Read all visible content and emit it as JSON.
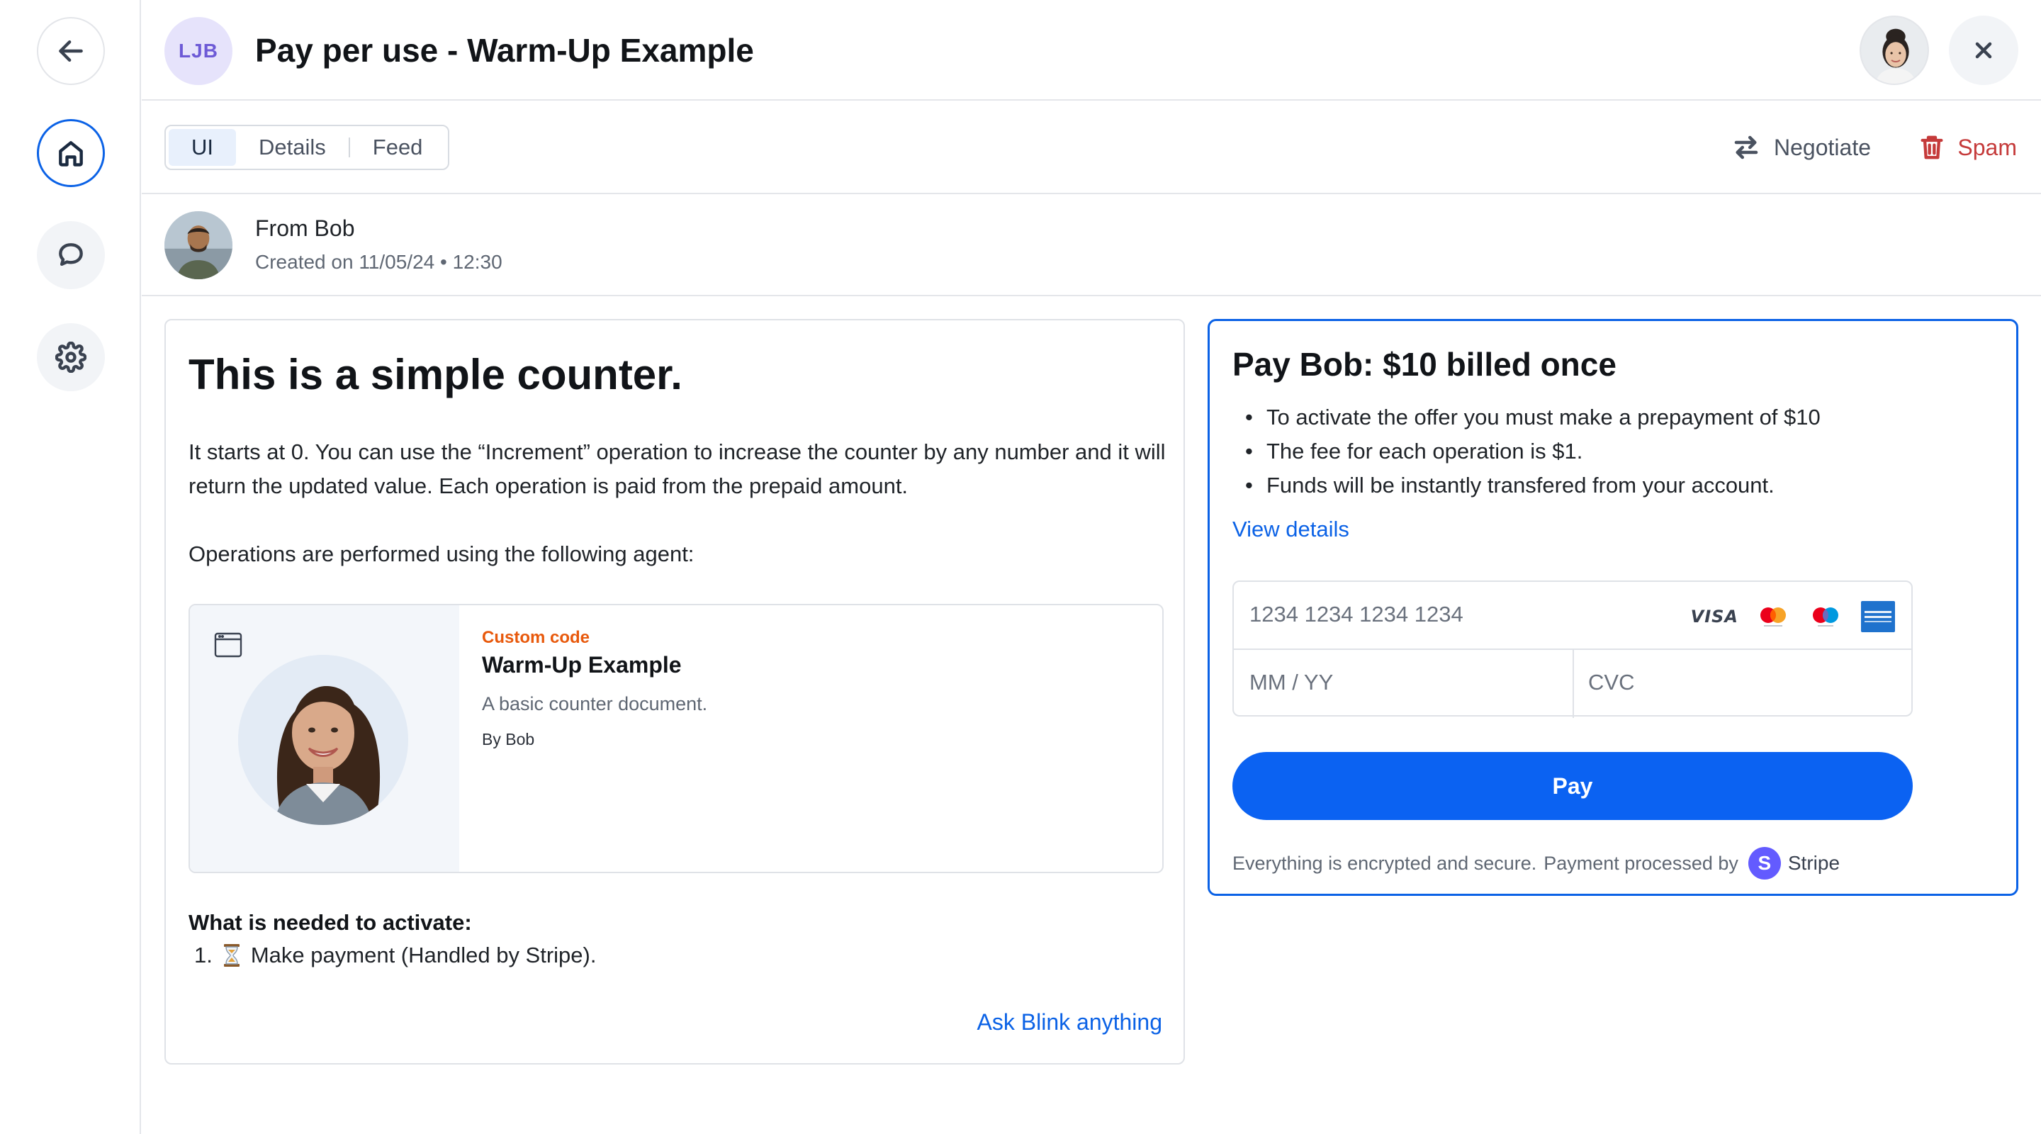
{
  "header": {
    "org_initials": "LJB",
    "title": "Pay per use - Warm-Up Example"
  },
  "toolbar": {
    "tabs": [
      {
        "label": "UI",
        "active": true
      },
      {
        "label": "Details",
        "active": false
      },
      {
        "label": "Feed",
        "active": false
      }
    ],
    "negotiate_label": "Negotiate",
    "spam_label": "Spam"
  },
  "from": {
    "name": "From Bob",
    "created": "Created on 11/05/24 • 12:30"
  },
  "content": {
    "title": "This is a simple counter.",
    "paragraph1": "It starts at 0. You can use the “Increment” operation to increase the counter by any number and it will return the updated value. Each operation is paid from the prepaid amount.",
    "paragraph2": "Operations are performed using the following agent:",
    "agent": {
      "tag": "Custom code",
      "name": "Warm-Up Example",
      "description": "A basic counter document.",
      "by": "By Bob"
    },
    "needed_title": "What is needed to activate:",
    "needed_items": [
      {
        "number": "1.",
        "text": "Make payment (Handled by Stripe)."
      }
    ],
    "ask_link": "Ask Blink anything"
  },
  "payment": {
    "title": "Pay Bob: $10 billed once",
    "bullets": [
      "To activate the offer you must make a prepayment of $10",
      "The fee for each operation is $1.",
      "Funds will be instantly transfered from your account."
    ],
    "view_details": "View details",
    "card_number_placeholder": "1234 1234 1234 1234",
    "expiry_placeholder": "MM / YY",
    "cvc_placeholder": "CVC",
    "brands": {
      "visa": "VISA"
    },
    "pay_button": "Pay",
    "secure_text": "Everything is encrypted and secure.",
    "processed_by": "Payment processed by",
    "stripe_initial": "S",
    "stripe_name": "Stripe"
  },
  "colors": {
    "accent": "#0b62e6",
    "pay_button": "#0b62f2",
    "danger": "#c53a3a",
    "tag": "#e8590c",
    "stripe": "#635bff"
  },
  "icons": {
    "back": "arrow-left-icon",
    "home": "home-icon",
    "chat": "chat-bubble-icon",
    "settings": "gear-icon",
    "close": "close-icon",
    "negotiate": "swap-arrows-icon",
    "spam": "trash-icon",
    "window": "window-icon",
    "hourglass": "hourglass-icon"
  }
}
